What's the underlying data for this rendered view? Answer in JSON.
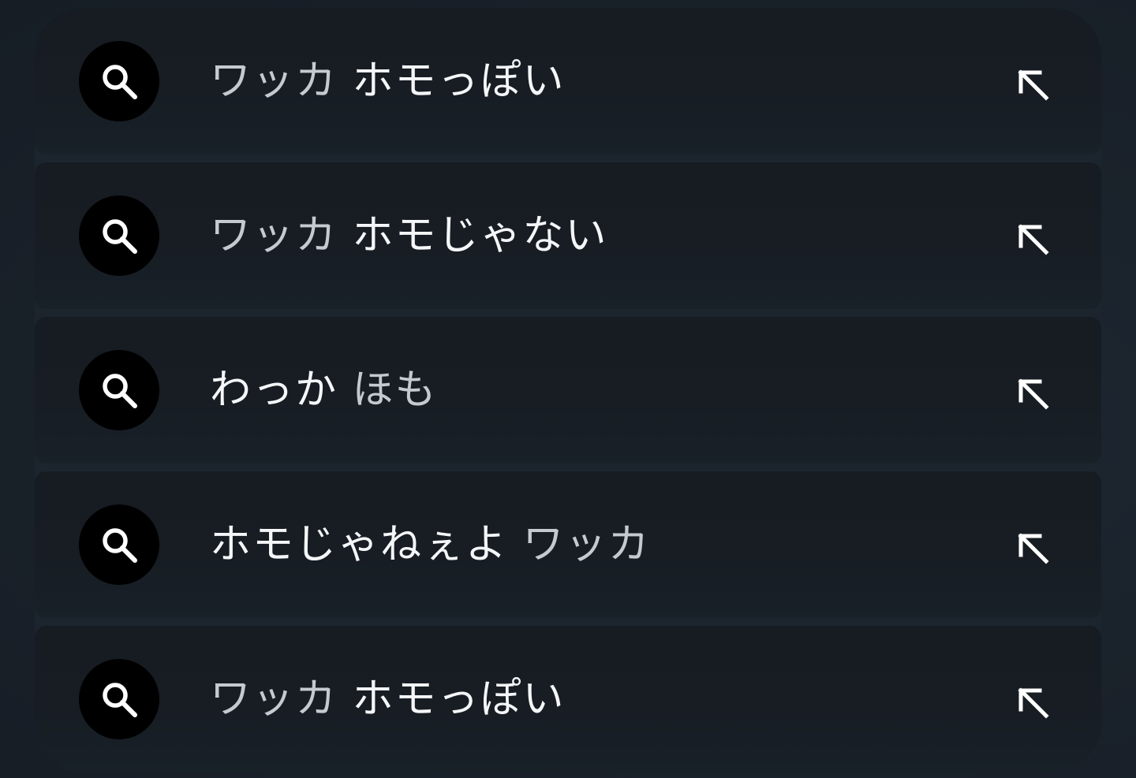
{
  "suggestions": [
    {
      "typed": "ワッカ",
      "suggested": "ホモっぽい",
      "order": "typed-first"
    },
    {
      "typed": "ワッカ",
      "suggested": "ホモじゃない",
      "order": "typed-first"
    },
    {
      "suggested": "わっか",
      "typed": "ほも",
      "order": "suggested-first"
    },
    {
      "suggested": "ホモじゃねぇよ",
      "typed": "ワッカ",
      "order": "suggested-first"
    },
    {
      "typed": "ワッカ",
      "suggested": "ホモっぽい",
      "order": "typed-first"
    }
  ],
  "icons": {
    "leading": "search-icon",
    "trailing": "arrow-up-left-icon"
  },
  "colors": {
    "background": "#1a222b",
    "row": "#171d23",
    "icon_circle": "#000000",
    "typed_text": "#c5cad1",
    "suggested_text": "#f4f6f8"
  }
}
